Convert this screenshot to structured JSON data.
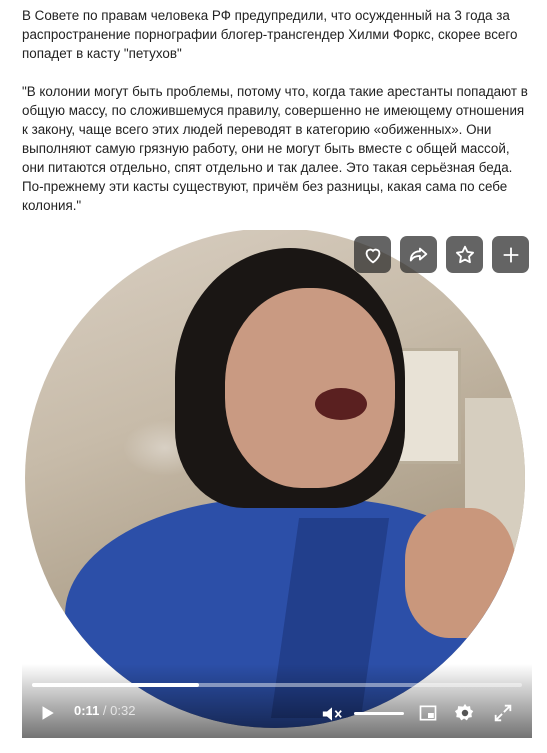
{
  "post": {
    "paragraph1": "В Совете по правам человека РФ предупредили, что осужденный на 3 года за распространение порнографии блогер-трансгендер Хилми Форкс, скорее всего попадет в касту \"петухов\"",
    "paragraph2": "\"В колонии могут быть проблемы, потому что, когда такие арестанты попадают в общую массу, по сложившемуся правилу, совершенно не имеющему отношения к закону, чаще всего этих людей переводят в категорию «обиженных». Они выполняют самую грязную работу, они не могут быть вместе с общей массой, они питаются отдельно, спят отдельно и так далее. Это такая серьёзная беда. По-прежнему эти касты существуют, причём без разницы, какая сама по себе колония.\""
  },
  "video": {
    "overlay_icons": [
      "heart-icon",
      "share-icon",
      "star-icon",
      "plus-icon"
    ],
    "current_time": "0:11",
    "separator": " / ",
    "duration": "0:32",
    "progress": 0.34,
    "muted": true,
    "colors": {
      "overlay_button": "#282828",
      "shirt": "#2c4fa8",
      "controls_text": "#ffffff"
    }
  }
}
